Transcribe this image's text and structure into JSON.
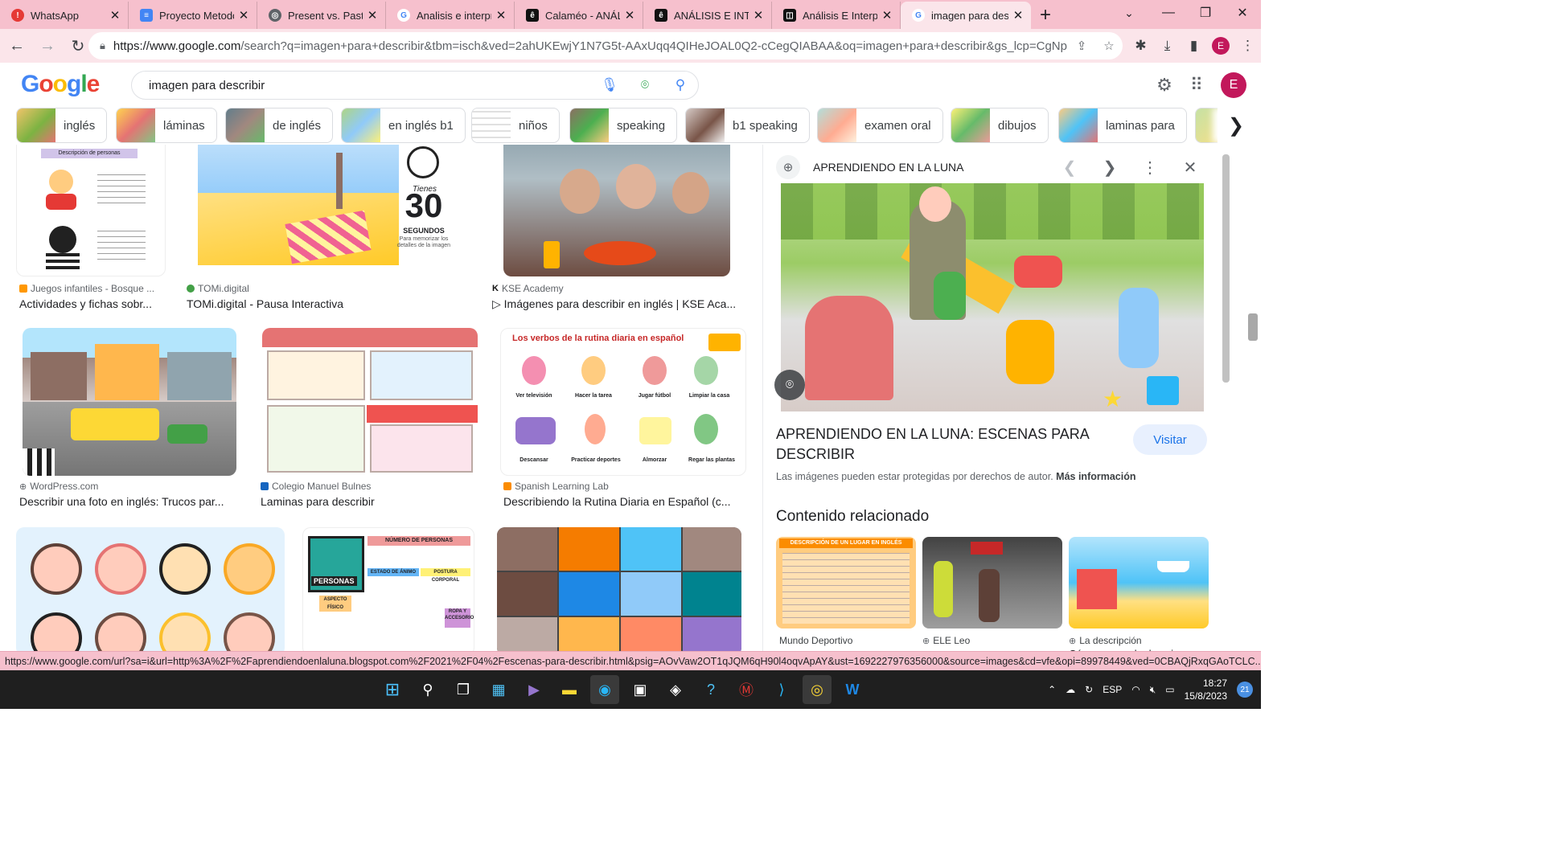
{
  "browser": {
    "tabs": [
      {
        "title": "WhatsApp",
        "color": "#e53935",
        "glyph": "!"
      },
      {
        "title": "Proyecto Metodo",
        "color": "#4285f4",
        "glyph": "≡"
      },
      {
        "title": "Present vs. Past T",
        "color": "#5f6368",
        "glyph": "◎"
      },
      {
        "title": "Analisis e interpre",
        "color": "#ffffff",
        "glyph": "G"
      },
      {
        "title": "Calaméo - ANÁLI",
        "color": "#111111",
        "glyph": "ê"
      },
      {
        "title": "ANÁLISIS E INTER",
        "color": "#111111",
        "glyph": "ê"
      },
      {
        "title": "Análisis E Interpre",
        "color": "#111111",
        "glyph": "◫"
      },
      {
        "title": "imagen para desc",
        "color": "#ffffff",
        "glyph": "G"
      }
    ],
    "url_host": "https://www.google.com",
    "url_path": "/search?q=imagen+para+describir&tbm=isch&ved=2ahUKEwjY1N7G5t-AAxUqq4QIHeJOAL0Q2-cCegQIABAA&oq=imagen+para+describir&gs_lcp=CgNpbWc...",
    "profile_initial": "E"
  },
  "google": {
    "logo": "Google",
    "query": "imagen para describir",
    "profile_initial": "E"
  },
  "chips": [
    "inglés",
    "láminas",
    "de inglés",
    "en inglés b1",
    "niños",
    "speaking",
    "b1 speaking",
    "examen oral",
    "dibujos",
    "laminas para"
  ],
  "results": [
    {
      "source": "Juegos infantiles - Bosque ...",
      "title": "Actividades y fichas sobr..."
    },
    {
      "source": "TOMi.digital",
      "title": "TOMi.digital - Pausa Interactiva"
    },
    {
      "source": "KSE Academy",
      "title": "▷ Imágenes para describir en inglés | KSE Aca..."
    },
    {
      "source": "WordPress.com",
      "title": "Describir una foto en inglés: Trucos par..."
    },
    {
      "source": "Colegio Manuel Bulnes",
      "title": "Laminas para describir"
    },
    {
      "source": "Spanish Learning Lab",
      "title": "Describiendo la Rutina Diaria en Español (c..."
    }
  ],
  "image_text": {
    "fichas_heading": "Descripción de personas",
    "tiempo_a": "Tienes",
    "tiempo_b": "30",
    "tiempo_c": "SEGUNDOS",
    "tiempo_d": "Para memorizar los detalles de la imagen",
    "rutina_title": "Los verbos de la rutina diaria en español",
    "rutina_labels": [
      "Ver televisión",
      "Hacer la tarea",
      "Jugar fútbol",
      "Limpiar la casa",
      "Descansar",
      "Practicar deportes",
      "Almorzar",
      "Regar las plantas"
    ],
    "personas_label": "PERSONAS",
    "personas_header": "NÚMERO DE PERSONAS",
    "personas_cells": [
      "ESTADO DE ÁNIMO",
      "POSTURA CORPORAL",
      "ASPECTO FÍSICO",
      "ROPA Y ACCESORIOS"
    ],
    "lugar_header": "DESCRIPCIÓN DE UN LUGAR EN INGLÉS"
  },
  "panel": {
    "site": "APRENDIENDO EN LA LUNA",
    "title": "APRENDIENDO EN LA LUNA: ESCENAS PARA DESCRIBIR",
    "visit": "Visitar",
    "copyright": "Las imágenes pueden estar protegidas por derechos de autor.",
    "more_info": "Más información",
    "related_heading": "Contenido relacionado",
    "related": [
      {
        "source": "Mundo Deportivo",
        "title": ""
      },
      {
        "source": "ELE Leo",
        "title": ""
      },
      {
        "source": "La descripción",
        "title": "Cómo se puede descri..."
      }
    ]
  },
  "status_url": "https://www.google.com/url?sa=i&url=http%3A%2F%2Faprendiendoenlaluna.blogspot.com%2F2021%2F04%2Fescenas-para-describir.html&psig=AOvVaw2OT1qJQM6qH90l4oqvApAY&ust=1692227976356000&source=images&cd=vfe&opi=89978449&ved=0CBAQjRxqGAoTCLC...",
  "taskbar": {
    "lang": "ESP",
    "time": "18:27",
    "date": "15/8/2023",
    "notif": "21"
  }
}
